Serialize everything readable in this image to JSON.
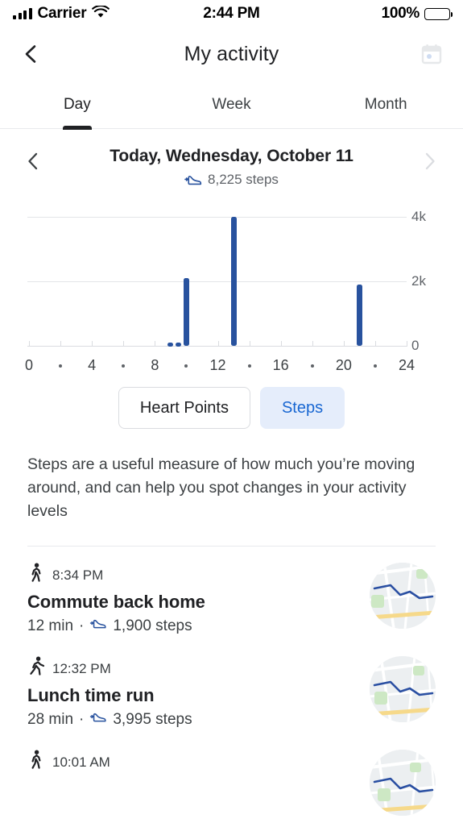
{
  "status_bar": {
    "carrier": "Carrier",
    "signal_icon": "cellular-signal-icon",
    "wifi_icon": "wifi-icon",
    "time": "2:44 PM",
    "battery_percent": "100%",
    "battery_icon": "battery-full-icon"
  },
  "header": {
    "back_icon": "back-chevron-icon",
    "title": "My activity",
    "calendar_icon": "calendar-icon"
  },
  "tabs": [
    {
      "label": "Day",
      "active": true
    },
    {
      "label": "Week",
      "active": false
    },
    {
      "label": "Month",
      "active": false
    }
  ],
  "date_nav": {
    "prev_icon": "chevron-left-icon",
    "next_icon": "chevron-right-icon",
    "title": "Today, Wednesday, October 11",
    "steps_icon": "shoe-steps-icon",
    "steps_summary": "8,225 steps"
  },
  "chart_data": {
    "type": "bar",
    "title": "",
    "xlabel": "",
    "ylabel": "",
    "x": [
      9,
      9.5,
      10,
      13,
      21
    ],
    "values": [
      90,
      95,
      2100,
      3995,
      1900
    ],
    "xlim": [
      0,
      24
    ],
    "ylim": [
      0,
      4000
    ],
    "xticks": [
      0,
      2,
      4,
      6,
      8,
      10,
      12,
      14,
      16,
      18,
      20,
      22,
      24
    ],
    "xtick_labels": [
      "0",
      "·",
      "4",
      "·",
      "8",
      "·",
      "12",
      "·",
      "16",
      "·",
      "20",
      "·",
      "24"
    ],
    "yticks": [
      0,
      2000,
      4000
    ],
    "ytick_labels": [
      "0",
      "2k",
      "4k"
    ],
    "grid": true,
    "bar_color": "#28529e",
    "legend": "none"
  },
  "metric_chips": [
    {
      "label": "Heart Points",
      "selected": false
    },
    {
      "label": "Steps",
      "selected": true
    }
  ],
  "description": "Steps are a useful measure of how much you’re moving around, and can help you spot changes in your activity levels",
  "activities": [
    {
      "type_icon": "walking-person-icon",
      "time": "8:34 PM",
      "title": "Commute back home",
      "duration": "12 min",
      "separator": "·",
      "steps_icon": "shoe-steps-icon",
      "steps": "1,900 steps",
      "thumbnail": "map-route-thumbnail"
    },
    {
      "type_icon": "running-person-icon",
      "time": "12:32 PM",
      "title": "Lunch time run",
      "duration": "28 min",
      "separator": "·",
      "steps_icon": "shoe-steps-icon",
      "steps": "3,995 steps",
      "thumbnail": "map-route-thumbnail"
    },
    {
      "type_icon": "walking-person-icon",
      "time": "10:01 AM",
      "title": "",
      "duration": "",
      "separator": "",
      "steps_icon": "",
      "steps": "",
      "thumbnail": "map-route-thumbnail"
    }
  ],
  "colors": {
    "bar_blue": "#28529e",
    "chip_blue_text": "#1967d2",
    "chip_blue_bg": "#e5edfb",
    "text_primary": "#202124",
    "text_secondary": "#3c4043",
    "text_muted": "#5f6368",
    "grid": "#e3e5e8"
  }
}
